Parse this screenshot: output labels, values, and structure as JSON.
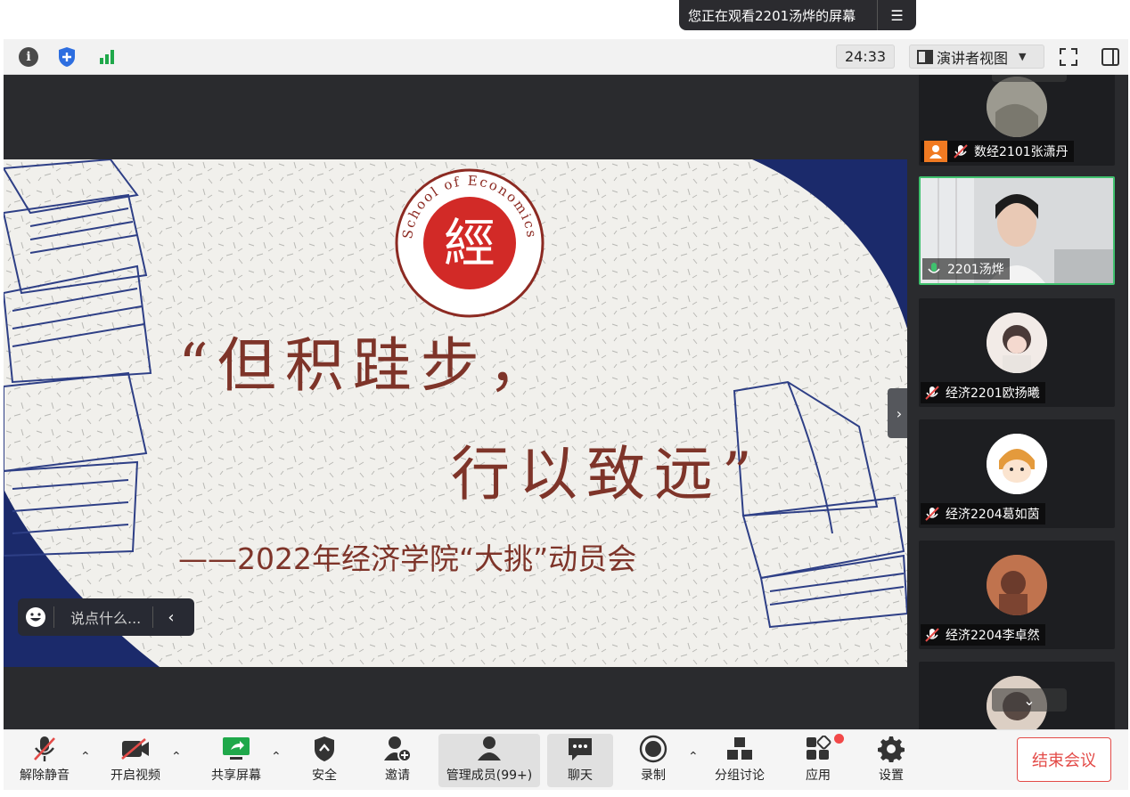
{
  "banner": {
    "text": "您正在观看2201汤烨的屏幕",
    "menu_icon": "list-menu-icon"
  },
  "toolbar": {
    "timer": "24:33",
    "view_label": "演讲者视图",
    "icons": [
      "info-icon",
      "shield-icon",
      "signal-icon",
      "fullscreen-icon",
      "sidebar-toggle-icon"
    ]
  },
  "slide": {
    "emblem_text": "School of Economics",
    "emblem_seal_char": "經",
    "quote_line1": "“但积跬步，",
    "quote_line2": "行以致远”",
    "subtitle": "——2022年经济学院“大挑”动员会"
  },
  "chat": {
    "placeholder": "说点什么..."
  },
  "participants": [
    {
      "name": "数经2101张潇丹",
      "muted": true,
      "video": false
    },
    {
      "name": "2201汤烨",
      "muted": false,
      "video": true,
      "active": true
    },
    {
      "name": "经济2201欧扬曦",
      "muted": true,
      "video": false
    },
    {
      "name": "经济2204葛如茵",
      "muted": true,
      "video": false
    },
    {
      "name": "经济2204李卓然",
      "muted": true,
      "video": false
    }
  ],
  "bottom": {
    "unmute": "解除静音",
    "start_video": "开启视频",
    "share": "共享屏幕",
    "security": "安全",
    "invite": "邀请",
    "participants": "管理成员(99+)",
    "chat": "聊天",
    "record": "录制",
    "breakout": "分组讨论",
    "apps": "应用",
    "settings": "设置",
    "end_meeting": "结束会议"
  },
  "colors": {
    "accent_red": "#e34a47",
    "slide_text": "#7e3429",
    "active_green": "#3fc16e",
    "slide_navy": "#1b2a6b"
  }
}
